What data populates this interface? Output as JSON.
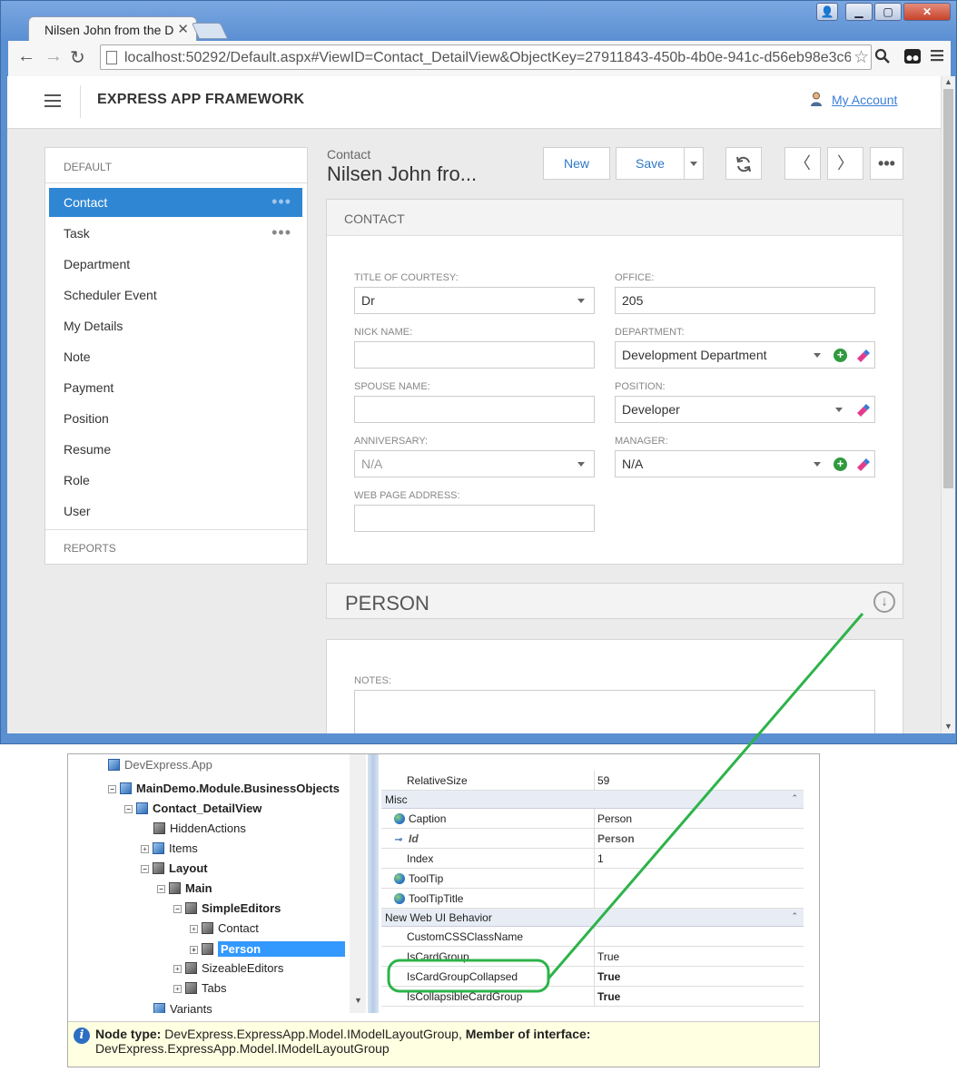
{
  "browser": {
    "tab_title": "Nilsen John from the D",
    "url": "localhost:50292/Default.aspx#ViewID=Contact_DetailView&ObjectKey=27911843-450b-4b0e-941c-d56eb98e3c6"
  },
  "app": {
    "title": "EXPRESS APP FRAMEWORK",
    "account_label": "My Account"
  },
  "nav": {
    "group_default": "DEFAULT",
    "group_reports": "REPORTS",
    "items": [
      {
        "label": "Contact",
        "active": true
      },
      {
        "label": "Task"
      },
      {
        "label": "Department"
      },
      {
        "label": "Scheduler Event"
      },
      {
        "label": "My Details"
      },
      {
        "label": "Note"
      },
      {
        "label": "Payment"
      },
      {
        "label": "Position"
      },
      {
        "label": "Resume"
      },
      {
        "label": "Role"
      },
      {
        "label": "User"
      }
    ],
    "more_glyph": "•••"
  },
  "detail": {
    "breadcrumb": "Contact",
    "title": "Nilsen John fro...",
    "buttons": {
      "new": "New",
      "save": "Save"
    }
  },
  "contact_card": {
    "caption": "CONTACT",
    "fields": {
      "title_of_courtesy": {
        "label": "TITLE OF COURTESY:",
        "value": "Dr"
      },
      "office": {
        "label": "OFFICE:",
        "value": "205"
      },
      "nick_name": {
        "label": "NICK NAME:",
        "value": ""
      },
      "department": {
        "label": "DEPARTMENT:",
        "value": "Development Department"
      },
      "spouse_name": {
        "label": "SPOUSE NAME:",
        "value": ""
      },
      "position": {
        "label": "POSITION:",
        "value": "Developer"
      },
      "anniversary": {
        "label": "ANNIVERSARY:",
        "value": "N/A"
      },
      "manager": {
        "label": "MANAGER:",
        "value": "N/A"
      },
      "web_page": {
        "label": "WEB PAGE ADDRESS:",
        "value": ""
      }
    }
  },
  "person_card": {
    "caption": "PERSON"
  },
  "notes_card": {
    "label": "NOTES:"
  },
  "model_tree": {
    "rows": [
      {
        "label": "DevExpress.App",
        "indent": 0
      },
      {
        "label": "MainDemo.Module.BusinessObjects",
        "indent": 1,
        "bold": true
      },
      {
        "label": "Contact_DetailView",
        "indent": 2,
        "bold": true
      },
      {
        "label": "HiddenActions",
        "indent": 3
      },
      {
        "label": "Items",
        "indent": 3
      },
      {
        "label": "Layout",
        "indent": 3,
        "bold": true
      },
      {
        "label": "Main",
        "indent": 4,
        "bold": true
      },
      {
        "label": "SimpleEditors",
        "indent": 5,
        "bold": true
      },
      {
        "label": "Contact",
        "indent": 6
      },
      {
        "label": "Person",
        "indent": 6,
        "selected": true
      },
      {
        "label": "SizeableEditors",
        "indent": 5
      },
      {
        "label": "Tabs",
        "indent": 5
      },
      {
        "label": "Variants",
        "indent": 3
      }
    ]
  },
  "property_grid": {
    "relative_size": {
      "name": "RelativeSize",
      "value": "59"
    },
    "cat_misc": "Misc",
    "caption": {
      "name": "Caption",
      "value": "Person"
    },
    "id": {
      "name": "Id",
      "value": "Person"
    },
    "index": {
      "name": "Index",
      "value": "1"
    },
    "tooltip": {
      "name": "ToolTip",
      "value": ""
    },
    "tooltip_title": {
      "name": "ToolTipTitle",
      "value": ""
    },
    "cat_web": "New Web UI Behavior",
    "custom_css": {
      "name": "CustomCSSClassName",
      "value": ""
    },
    "is_card_group": {
      "name": "IsCardGroup",
      "value": "True"
    },
    "is_card_group_collapsed": {
      "name": "IsCardGroupCollapsed",
      "value": "True"
    },
    "is_collapsible": {
      "name": "IsCollapsibleCardGroup",
      "value": "True"
    }
  },
  "infobar": {
    "node_type_label": "Node type:",
    "node_type_value": "DevExpress.ExpressApp.Model.IModelLayoutGroup,",
    "member_label": "Member of interface:",
    "member_value": "DevExpress.ExpressApp.Model.IModelLayoutGroup"
  },
  "colors": {
    "accent": "#2f87d3",
    "annotation": "#2db34a"
  }
}
